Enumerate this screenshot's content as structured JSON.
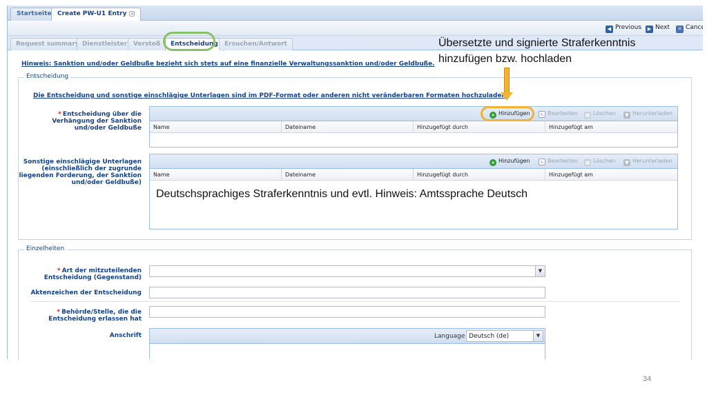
{
  "doc_tabs": [
    {
      "label": "Startseite",
      "active": false
    },
    {
      "label": "Create PW-U1 Entry",
      "active": true
    }
  ],
  "toolbar": {
    "previous_label": "Previous",
    "next_label": "Next",
    "cancel_label": "Cance"
  },
  "sub_tabs": [
    {
      "label": "Request summary",
      "active": false
    },
    {
      "label": "Dienstleister",
      "active": false
    },
    {
      "label": "Verstoß",
      "active": false
    },
    {
      "label": "Entscheidung",
      "active": true
    },
    {
      "label": "Ersuchen/Antwort",
      "active": false
    }
  ],
  "hint": "Hinweis: Sanktion und/oder Geldbuße bezieht sich stets auf eine finanzielle Verwaltungssanktion und/oder Geldbuße.",
  "entscheidung": {
    "legend": "Entscheidung",
    "upload_hint": "Die Entscheidung und sonstige einschlägige Unterlagen sind im PDF-Format oder anderen nicht veränderbaren Formaten hochzuladen.",
    "decision_label": "Entscheidung über die Verhängung der Sanktion und/oder Geldbuße",
    "other_label": "Sonstige einschlägige Unterlagen (einschließlich der zugrunde liegenden Forderung, der Sanktion und/oder Geldbuße)",
    "required_mark": "*"
  },
  "grid": {
    "buttons": {
      "add": "Hinzufügen",
      "edit": "Bearbeiten",
      "delete": "Löschen",
      "download": "Herunterladen"
    },
    "columns": [
      "Name",
      "Dateiname",
      "Hinzugefügt durch",
      "Hinzugefügt am"
    ]
  },
  "einzelheiten": {
    "legend": "Einzelheiten",
    "art_label": "Art der mitzuteilenden Entscheidung (Gegenstand)",
    "aktenzeichen_label": "Aktenzeichen der Entscheidung",
    "behoerde_label": "Behörde/Stelle, die die Entscheidung erlassen hat",
    "anschrift_label": "Anschrift",
    "language_label": "Language",
    "language_value": "Deutsch (de)",
    "art_value": "",
    "aktenzeichen_value": "",
    "behoerde_value": ""
  },
  "annotations": {
    "top_line1": "Übersetzte und signierte Straferkenntnis",
    "top_line2": "hinzufügen bzw. hochladen",
    "middle": "Deutschsprachiges Straferkenntnis und evtl. Hinweis: Amtssprache Deutsch",
    "arrow_color": "#f2b233",
    "green_ring_color": "#86c166"
  },
  "page_number": "34"
}
